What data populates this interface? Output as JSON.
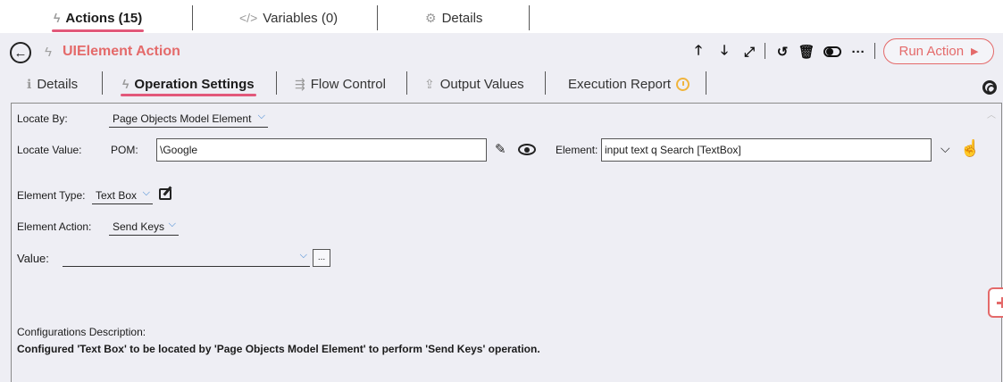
{
  "top_tabs": [
    {
      "label": "Actions (15)",
      "icon": "bolt-icon",
      "active": true
    },
    {
      "label": "Variables (0)",
      "icon": "code-icon",
      "active": false
    },
    {
      "label": "Details",
      "icon": "gear-icon",
      "active": false
    }
  ],
  "header": {
    "title": "UIElement Action",
    "run_action_label": "Run Action"
  },
  "sub_tabs": [
    {
      "label": "Details",
      "icon": "info-icon"
    },
    {
      "label": "Operation Settings",
      "icon": "bolt-icon",
      "active": true
    },
    {
      "label": "Flow Control",
      "icon": "flow-icon"
    },
    {
      "label": "Output Values",
      "icon": "upload-icon"
    },
    {
      "label": "Execution Report",
      "icon": "clock-icon"
    }
  ],
  "form": {
    "locate_by_label": "Locate By:",
    "locate_by_value": "Page Objects Model Element",
    "locate_value_label": "Locate Value:",
    "pom_label": "POM:",
    "pom_value": "\\Google",
    "element_label": "Element:",
    "element_value": "input text q Search [TextBox]",
    "element_type_label": "Element Type:",
    "element_type_value": "Text Box",
    "element_action_label": "Element Action:",
    "element_action_value": "Send Keys",
    "value_label": "Value:",
    "value_value": "",
    "browse_label": "..."
  },
  "description": {
    "title": "Configurations Description:",
    "text": "Configured 'Text Box' to be located by 'Page Objects Model Element' to perform 'Send Keys' operation."
  },
  "colors": {
    "accent": "#e46a6a",
    "tab_underline": "#e2587a",
    "chevron": "#2f7bd0"
  }
}
